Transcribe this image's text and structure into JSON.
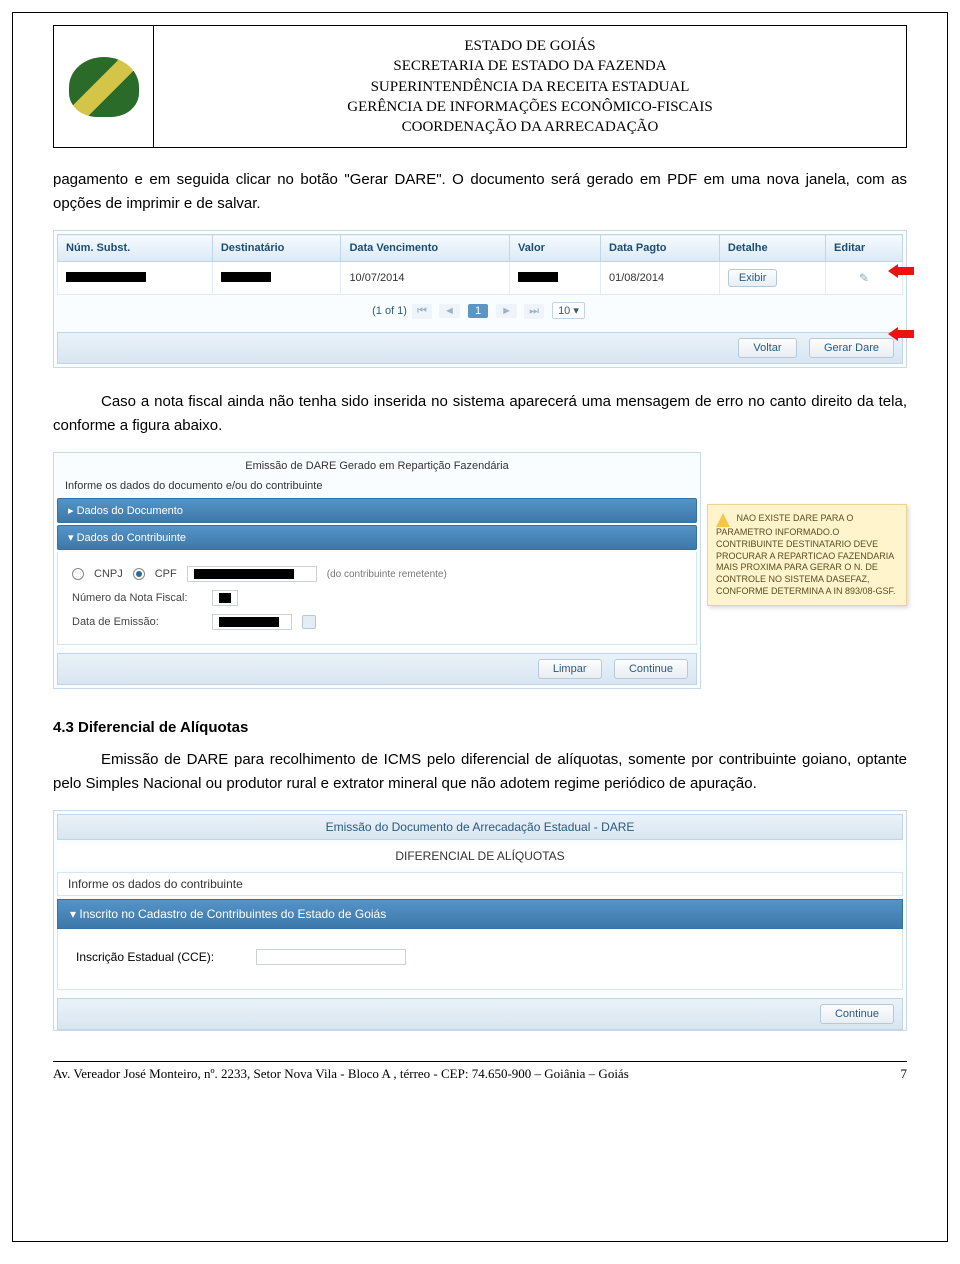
{
  "header": {
    "line1": "ESTADO DE GOIÁS",
    "line2": "SECRETARIA DE ESTADO DA FAZENDA",
    "line3": "SUPERINTENDÊNCIA DA RECEITA ESTADUAL",
    "line4": "GERÊNCIA DE INFORMAÇÕES ECONÔMICO-FISCAIS",
    "line5": "COORDENAÇÃO DA ARRECADAÇÃO"
  },
  "para1": "pagamento e em seguida clicar no botão \"Gerar DARE\". O documento será gerado em PDF em uma nova janela, com as opções de imprimir e de salvar.",
  "tbl": {
    "cols": [
      "Núm. Subst.",
      "Destinatário",
      "Data Vencimento",
      "Valor",
      "Data Pagto",
      "Detalhe",
      "Editar"
    ],
    "row": {
      "venc": "10/07/2014",
      "pagto": "01/08/2014",
      "detalhe": "Exibir"
    },
    "pager": {
      "label": "(1 of 1)",
      "page": "1",
      "size": "10 ▾"
    },
    "voltar": "Voltar",
    "gerar": "Gerar Dare"
  },
  "para2": "Caso a nota fiscal ainda não tenha sido inserida no sistema aparecerá uma mensagem de erro no canto direito da tela, conforme a figura abaixo.",
  "form2": {
    "title": "Emissão de DARE Gerado em Repartição Fazendária",
    "hint": "Informe os dados do documento e/ou do contribuinte",
    "sec1": "▸ Dados do Documento",
    "sec2": "▾ Dados do Contribuinte",
    "cnpj": "CNPJ",
    "cpf": "CPF",
    "rem": "(do contribuinte remetente)",
    "lnf": "Número da Nota Fiscal:",
    "lde": "Data de Emissão:",
    "limpar": "Limpar",
    "continue": "Continue"
  },
  "warn": "NAO EXISTE DARE PARA O PARAMETRO INFORMADO.O CONTRIBUINTE DESTINATARIO DEVE PROCURAR A REPARTICAO FAZENDARIA MAIS PROXIMA PARA GERAR O N. DE CONTROLE NO SISTEMA DASEFAZ, CONFORME DETERMINA A IN 893/08-GSF.",
  "sec43": {
    "title": "4.3 Diferencial de Alíquotas",
    "text": "Emissão de DARE para recolhimento de ICMS pelo diferencial de alíquotas, somente por contribuinte goiano, optante pelo Simples Nacional ou produtor rural e extrator mineral que não adotem regime periódico de apuração."
  },
  "form3": {
    "title": "Emissão do Documento de Arrecadação Estadual - DARE",
    "subtitle": "DIFERENCIAL DE ALÍQUOTAS",
    "hint": "Informe os dados do contribuinte",
    "sec": "▾ Inscrito no Cadastro de Contribuintes do Estado de Goiás",
    "lbl": "Inscrição Estadual (CCE):",
    "continue": "Continue"
  },
  "footer": {
    "addr": "Av. Vereador José Monteiro, nº. 2233, Setor Nova Vila - Bloco A , térreo - CEP: 74.650-900 – Goiânia – Goiás",
    "page": "7"
  }
}
